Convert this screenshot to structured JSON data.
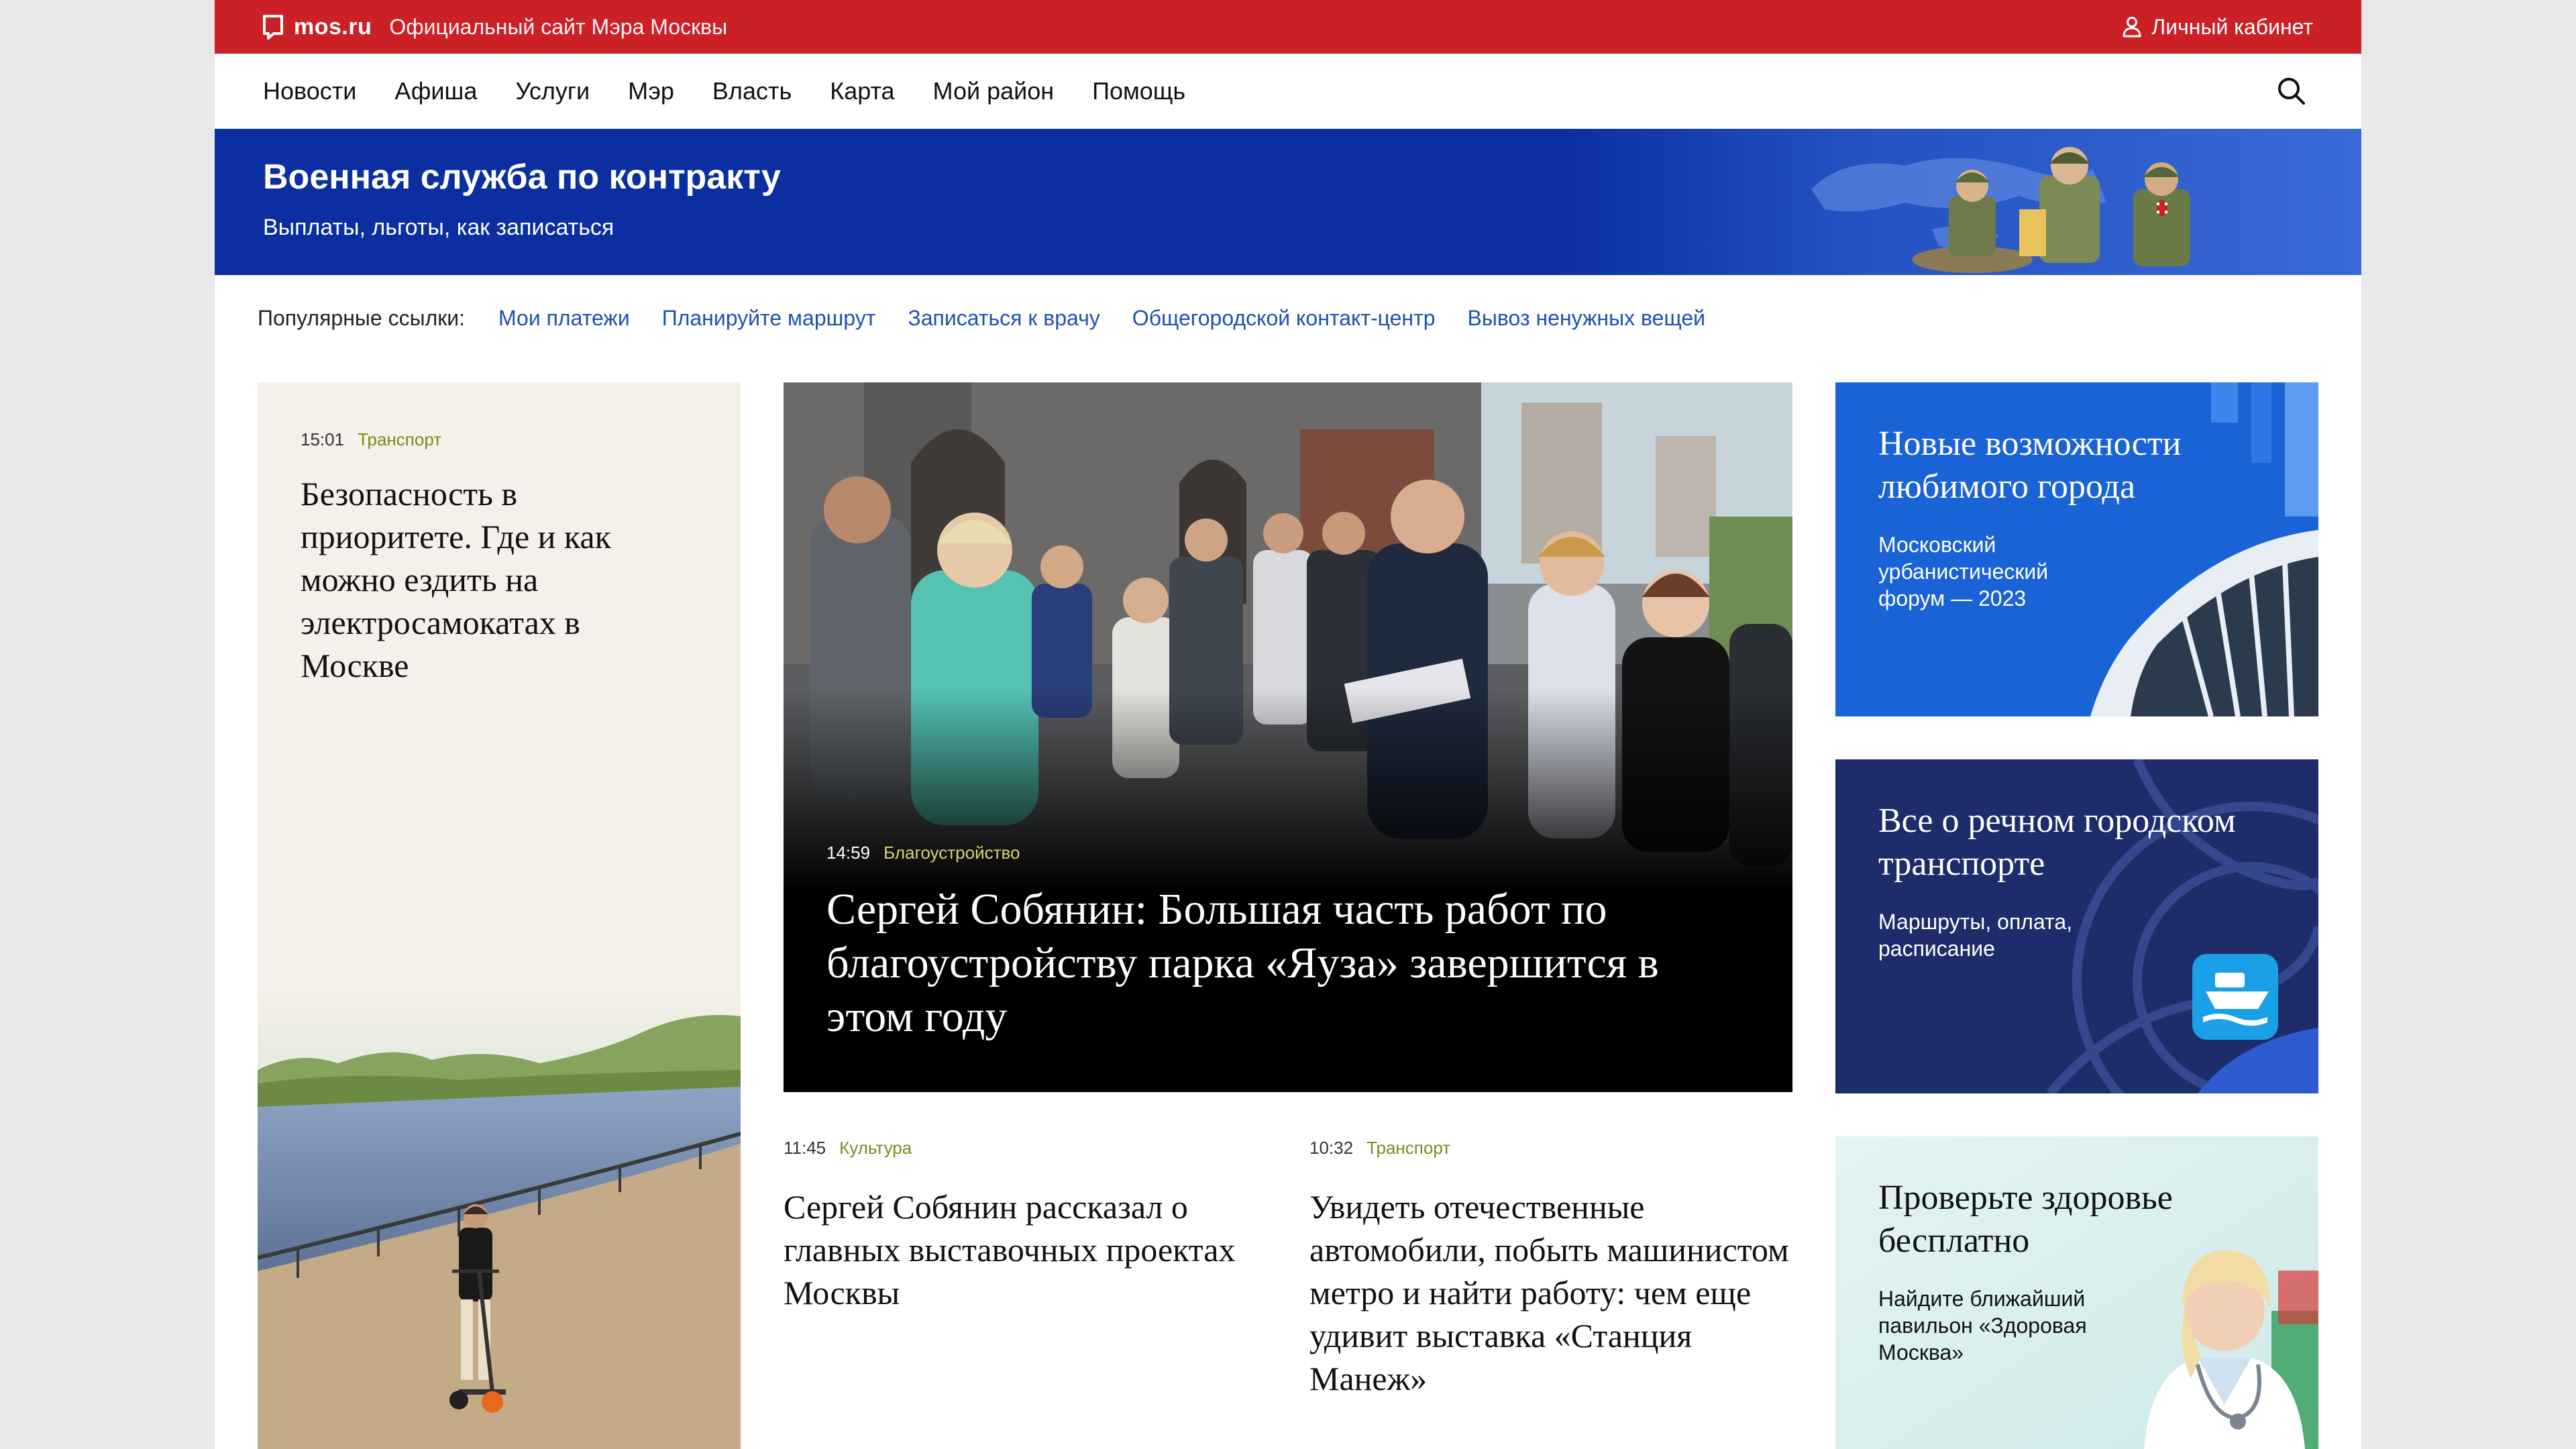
{
  "topbar": {
    "logo_text": "mos.ru",
    "site_title": "Официальный сайт Мэра Москвы",
    "cabinet_label": "Личный кабинет"
  },
  "nav": {
    "items": [
      "Новости",
      "Афиша",
      "Услуги",
      "Мэр",
      "Власть",
      "Карта",
      "Мой район",
      "Помощь"
    ]
  },
  "banner": {
    "title": "Военная служба по контракту",
    "subtitle": "Выплаты, льготы, как записаться"
  },
  "popular": {
    "label": "Популярные ссылки:",
    "links": [
      "Мои платежи",
      "Планируйте маршрут",
      "Записаться к врачу",
      "Общегородской контакт-центр",
      "Вывоз ненужных вещей"
    ]
  },
  "left_card": {
    "time": "15:01",
    "category": "Транспорт",
    "headline": "Безопасность в приоритете. Где и как можно ездить на электросамокатах в Москве"
  },
  "main_card": {
    "time": "14:59",
    "category": "Благоустройство",
    "headline": "Сергей Собянин: Большая часть работ по благоустройству парка «Яуза» завершится в этом году"
  },
  "news": [
    {
      "time": "11:45",
      "category": "Культура",
      "headline": "Сергей Собянин рассказал о главных выставочных проектах Москвы"
    },
    {
      "time": "10:32",
      "category": "Транспорт",
      "headline": "Увидеть отечественные автомобили, побыть машинистом метро и найти работу: чем еще удивит выставка «Станция Манеж»"
    }
  ],
  "promos": [
    {
      "title": "Новые возможности любимого города",
      "subtitle": "Московский урбанистический форум — 2023"
    },
    {
      "title": "Все о речном городском транспорте",
      "subtitle": "Маршруты, оплата, расписание"
    },
    {
      "title": "Проверьте здоровье бесплатно",
      "subtitle": "Найдите ближайший павильон «Здоровая Москва»"
    }
  ],
  "colors": {
    "topbar": "#cc2027",
    "banner": "#0b2ea0",
    "link": "#1d50b5",
    "category": "#7b8a1c"
  }
}
